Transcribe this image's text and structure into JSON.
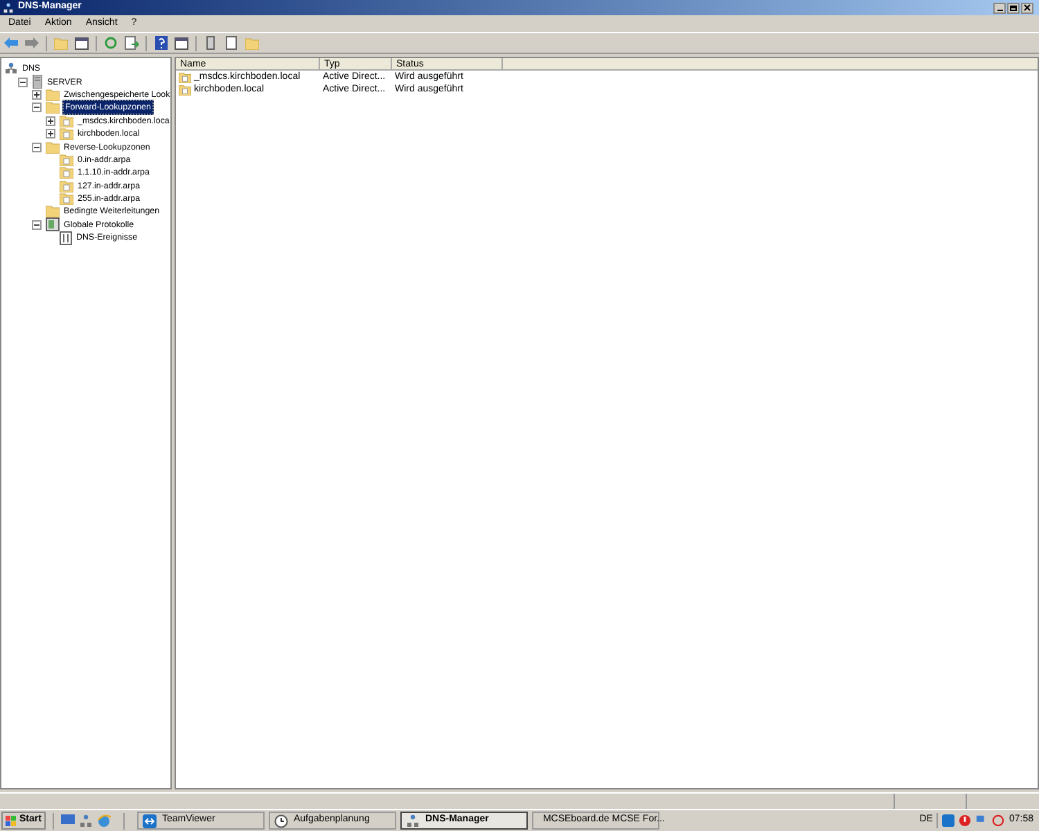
{
  "window": {
    "title": "DNS-Manager"
  },
  "menu": [
    "Datei",
    "Aktion",
    "Ansicht",
    "?"
  ],
  "tree": [
    {
      "label": "DNS",
      "kind": "root",
      "expandable": false,
      "expanded": true,
      "selected": false,
      "children": [
        {
          "label": "SERVER",
          "kind": "server",
          "expandable": true,
          "expanded": true,
          "selected": false,
          "children": [
            {
              "label": "Zwischengespeicherte Look",
              "kind": "folder",
              "expandable": true,
              "expanded": false,
              "selected": false
            },
            {
              "label": "Forward-Lookupzonen",
              "kind": "folder",
              "expandable": true,
              "expanded": true,
              "selected": true,
              "children": [
                {
                  "label": "_msdcs.kirchboden.loca",
                  "kind": "zone",
                  "expandable": true,
                  "expanded": false,
                  "selected": false
                },
                {
                  "label": "kirchboden.local",
                  "kind": "zone",
                  "expandable": true,
                  "expanded": false,
                  "selected": false
                }
              ]
            },
            {
              "label": "Reverse-Lookupzonen",
              "kind": "folder",
              "expandable": true,
              "expanded": true,
              "selected": false,
              "children": [
                {
                  "label": "0.in-addr.arpa",
                  "kind": "zone",
                  "expandable": false,
                  "expanded": false,
                  "selected": false
                },
                {
                  "label": "1.1.10.in-addr.arpa",
                  "kind": "zone",
                  "expandable": false,
                  "expanded": false,
                  "selected": false
                },
                {
                  "label": "127.in-addr.arpa",
                  "kind": "zone",
                  "expandable": false,
                  "expanded": false,
                  "selected": false
                },
                {
                  "label": "255.in-addr.arpa",
                  "kind": "zone",
                  "expandable": false,
                  "expanded": false,
                  "selected": false
                }
              ]
            },
            {
              "label": "Bedingte Weiterleitungen",
              "kind": "folder",
              "expandable": false,
              "expanded": false,
              "selected": false
            },
            {
              "label": "Globale Protokolle",
              "kind": "logs",
              "expandable": true,
              "expanded": true,
              "selected": false,
              "children": [
                {
                  "label": "DNS-Ereignisse",
                  "kind": "log",
                  "expandable": false,
                  "expanded": false,
                  "selected": false
                }
              ]
            }
          ]
        }
      ]
    }
  ],
  "table": {
    "columns": [
      "Name",
      "Typ",
      "Status"
    ],
    "rows": [
      [
        "_msdcs.kirchboden.local",
        "Active Direct...",
        "Wird ausgeführt"
      ],
      [
        "kirchboden.local",
        "Active Direct...",
        "Wird ausgeführt"
      ]
    ]
  },
  "taskbar": {
    "start": "Start",
    "tasks": [
      {
        "label": "TeamViewer",
        "kind": "teamviewer",
        "selected": false
      },
      {
        "label": "Aufgabenplanung",
        "kind": "clock",
        "selected": false
      },
      {
        "label": "DNS-Manager",
        "kind": "dns",
        "selected": true
      },
      {
        "label": "MCSEboard.de MCSE For...",
        "kind": "browser",
        "selected": false
      }
    ],
    "language": "DE",
    "time": "07:58"
  }
}
